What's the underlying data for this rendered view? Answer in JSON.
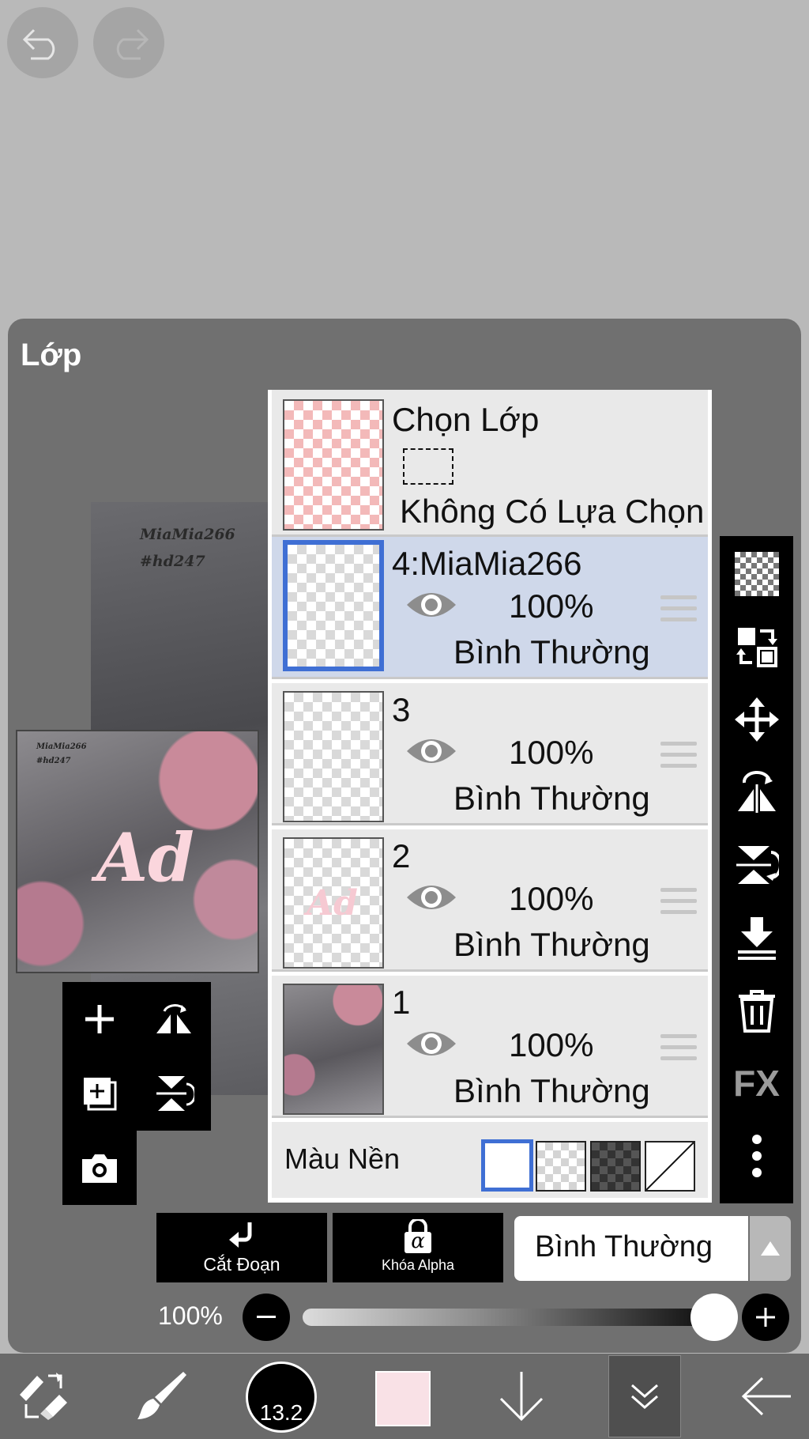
{
  "panel": {
    "title": "Lớp"
  },
  "selection_layer": {
    "title": "Chọn Lớp",
    "status": "Không Có Lựa Chọn"
  },
  "layers": [
    {
      "name": "4:MiaMia266",
      "opacity": "100%",
      "mode": "Bình Thường",
      "selected": true
    },
    {
      "name": "3",
      "opacity": "100%",
      "mode": "Bình Thường",
      "selected": false
    },
    {
      "name": "2",
      "opacity": "100%",
      "mode": "Bình Thường",
      "selected": false
    },
    {
      "name": "1",
      "opacity": "100%",
      "mode": "Bình Thường",
      "selected": false
    }
  ],
  "preview": {
    "watermark_line1": "MiaMia266",
    "watermark_line2": "#hd247",
    "sticker_text": "Ad"
  },
  "background": {
    "label": "Màu Nền"
  },
  "sidebar": {
    "fx_label": "FX"
  },
  "actions": {
    "clip_label": "Cắt Đoạn",
    "alpha_lock_label": "Khóa Alpha",
    "alpha_symbol": "α"
  },
  "blend_mode": {
    "value": "Bình Thường"
  },
  "opacity_slider": {
    "label": "100%",
    "value": 1.0
  },
  "bottom_bar": {
    "brush_size": "13.2",
    "color": "#f9e1e6"
  },
  "colors": {
    "accent": "#3f6fd4",
    "panel": "#707070",
    "selected_row": "#cfd8ea"
  }
}
